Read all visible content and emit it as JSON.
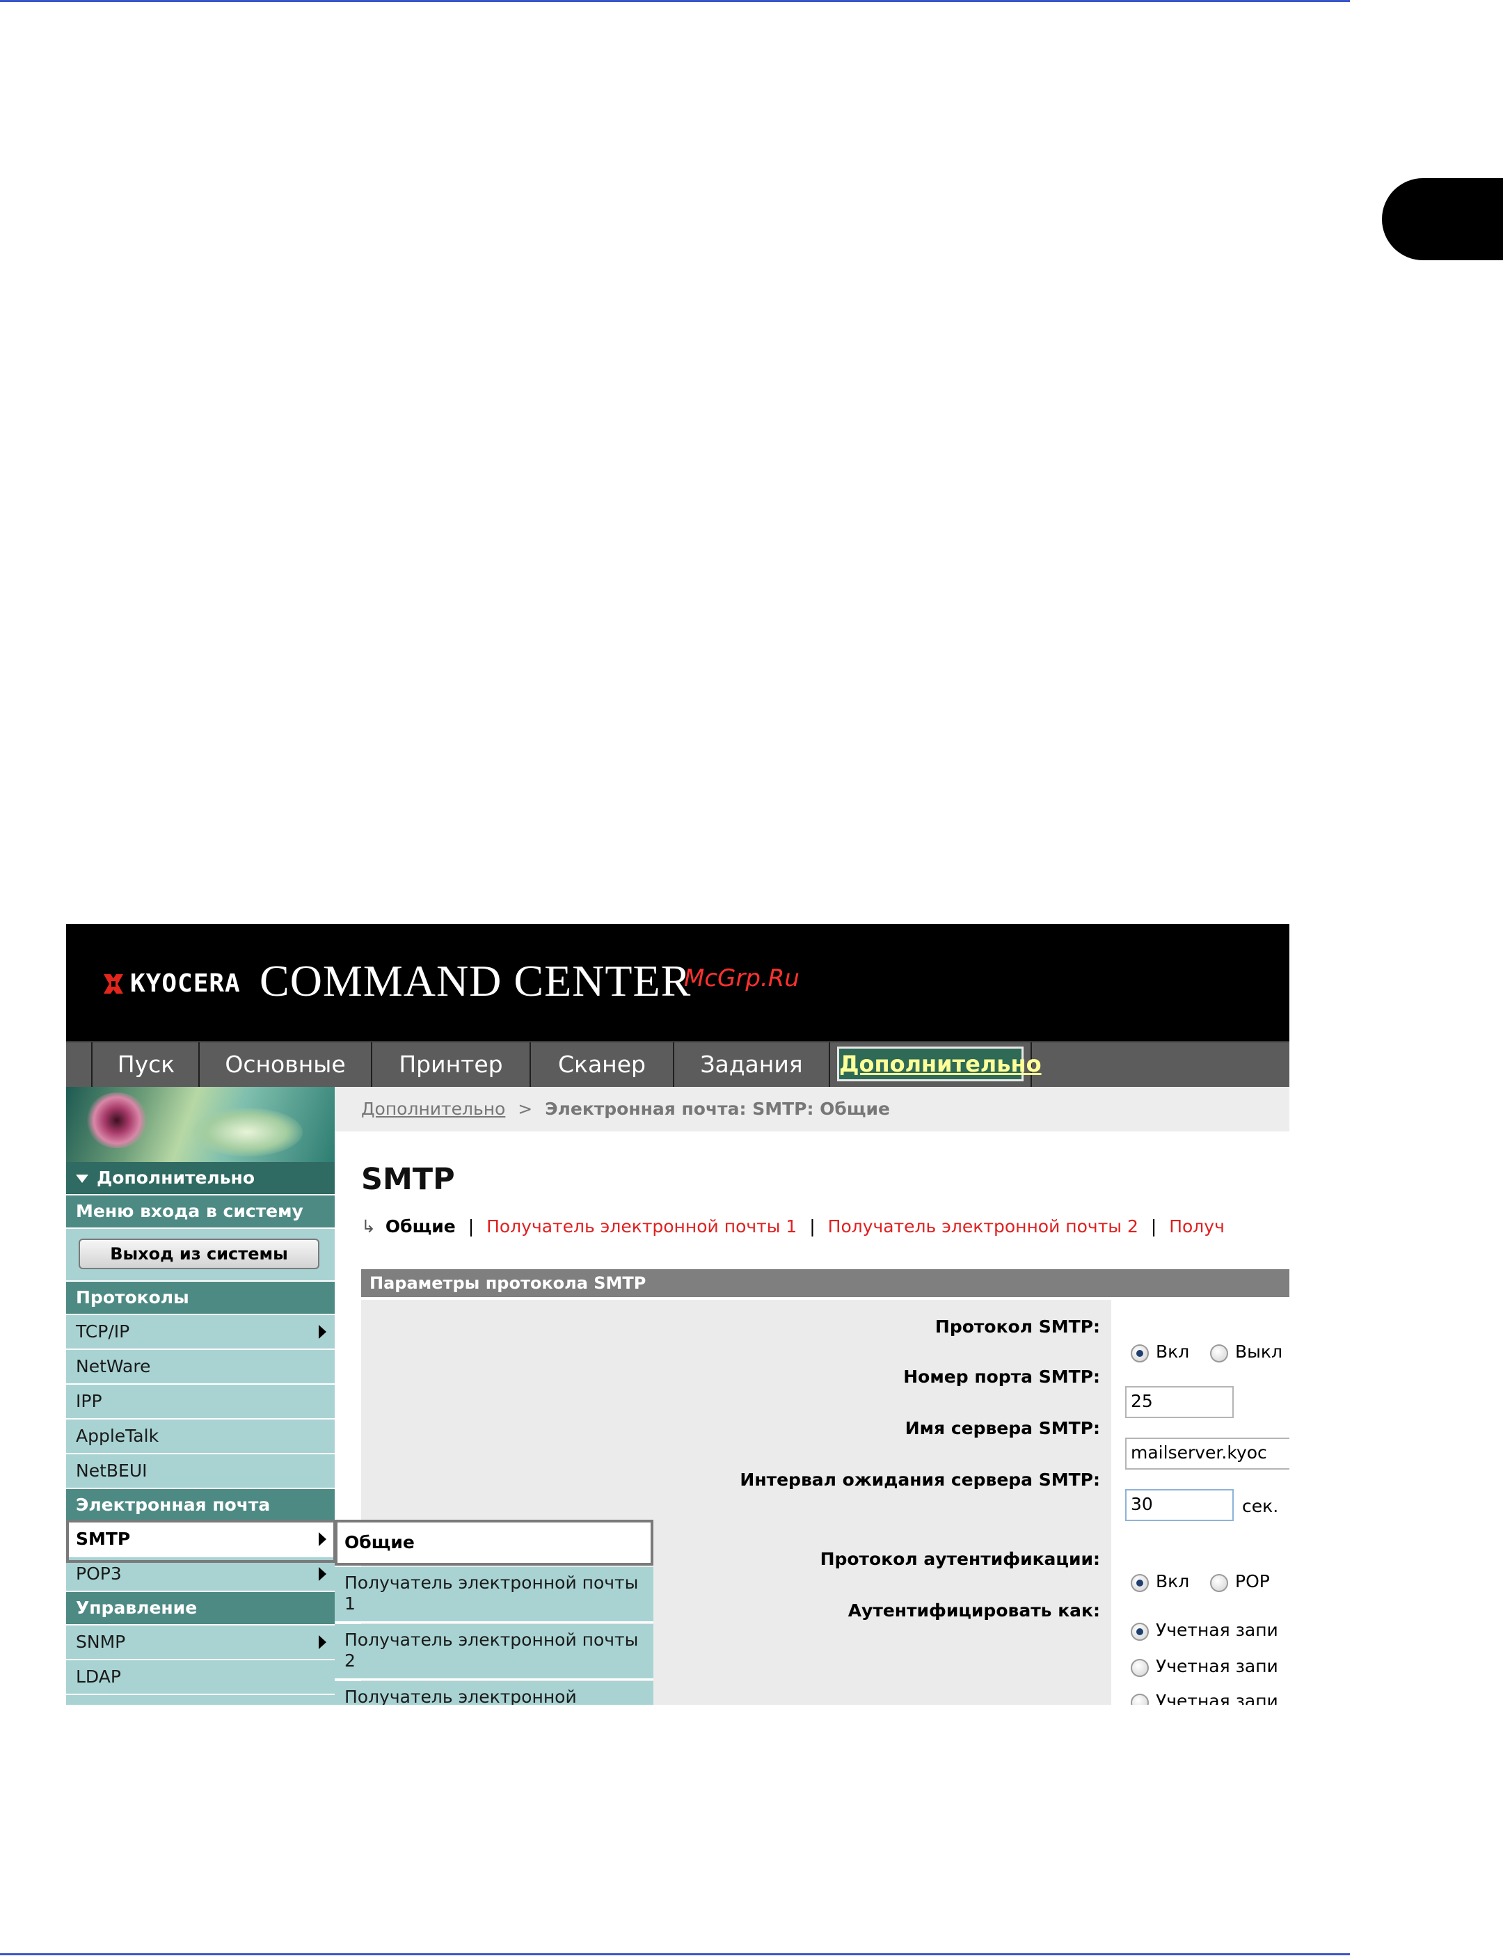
{
  "header": {
    "logo_text": "KYOCERA",
    "title": "COMMAND CENTER",
    "watermark": "McGrp.Ru"
  },
  "nav": {
    "tabs": [
      "Пуск",
      "Основные",
      "Принтер",
      "Сканер",
      "Задания",
      "Дополнительно"
    ],
    "active_tab": "Дополнительно"
  },
  "sidebar": {
    "section_title": "Дополнительно",
    "login_menu": "Меню входа в систему",
    "logout_button": "Выход из системы",
    "protocols_header": "Протоколы",
    "protocols": [
      "TCP/IP",
      "NetWare",
      "IPP",
      "AppleTalk",
      "NetBEUI"
    ],
    "email_header": "Электронная почта",
    "email_items": [
      "SMTP",
      "POP3"
    ],
    "management_header": "Управление",
    "management_items": [
      "SNMP",
      "LDAP"
    ]
  },
  "flyout": {
    "items": [
      "Общие",
      "Получатель электронной почты 1",
      "Получатель электронной почты 2",
      "Получатель электронной"
    ]
  },
  "breadcrumb": {
    "link": "Дополнительно",
    "separator": ">",
    "current": "Электронная почта: SMTP: Общие"
  },
  "page": {
    "title": "SMTP",
    "subnav": {
      "current": "Общие",
      "links": [
        "Получатель электронной почты 1",
        "Получатель электронной почты 2",
        "Получ"
      ]
    },
    "section_title": "Параметры протокола SMTP"
  },
  "form": {
    "smtp_protocol": {
      "label": "Протокол SMTP:",
      "options": [
        "Вкл",
        "Выкл"
      ],
      "selected": "Вкл"
    },
    "smtp_port": {
      "label": "Номер порта SMTP:",
      "value": "25"
    },
    "smtp_server": {
      "label": "Имя сервера SMTP:",
      "value": "mailserver.kyoc"
    },
    "smtp_timeout": {
      "label": "Интервал ожидания сервера SMTP:",
      "value": "30",
      "unit": "сек."
    },
    "auth_protocol": {
      "label": "Протокол аутентификации:",
      "options": [
        "Вкл",
        "POP"
      ],
      "selected": "Вкл"
    },
    "auth_as": {
      "label": "Аутентифицировать как:",
      "options": [
        "Учетная запи",
        "Учетная запи",
        "Учетная запи"
      ],
      "selected_index": 0
    }
  },
  "colors": {
    "accent_blue": "#3a56c8",
    "nav_active_bg": "#2e6a55",
    "nav_active_text": "#ffff99",
    "sidebar_bg": "#a9d3d3",
    "sidebar_header": "#4e8a84",
    "link_red": "#e02020"
  },
  "icons": {
    "logo_mark": "kyocera-logo-icon",
    "submenu_arrow": "arrow-right-icon",
    "section_toggle": "triangle-down-icon",
    "subnav_marker": "return-arrow-icon"
  }
}
